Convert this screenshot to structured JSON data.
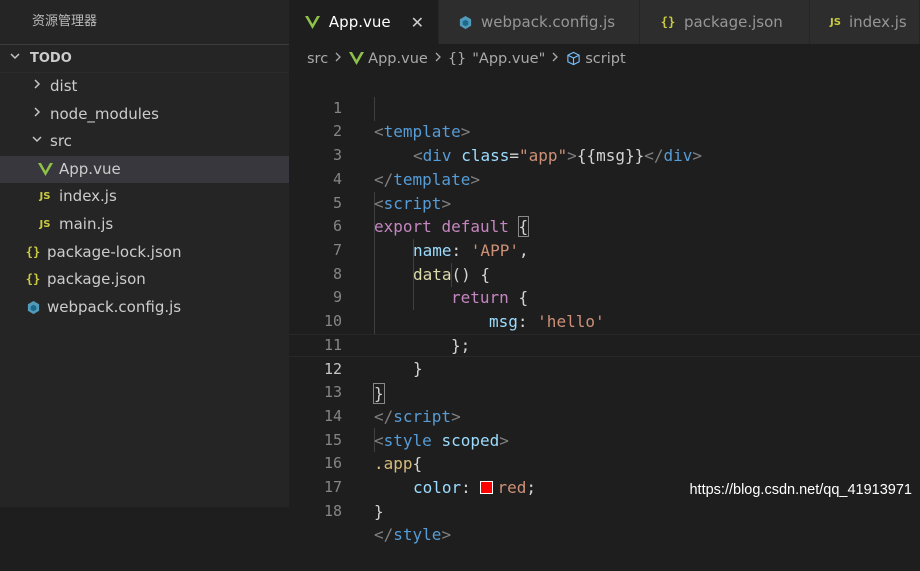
{
  "sidebar": {
    "title": "资源管理器",
    "section": "TODO",
    "items": [
      {
        "label": "dist",
        "kind": "folder",
        "open": false
      },
      {
        "label": "node_modules",
        "kind": "folder",
        "open": false
      },
      {
        "label": "src",
        "kind": "folder",
        "open": true
      },
      {
        "label": "App.vue",
        "kind": "vue",
        "selected": true
      },
      {
        "label": "index.js",
        "kind": "js"
      },
      {
        "label": "main.js",
        "kind": "js"
      },
      {
        "label": "package-lock.json",
        "kind": "json"
      },
      {
        "label": "package.json",
        "kind": "json"
      },
      {
        "label": "webpack.config.js",
        "kind": "webpack"
      }
    ]
  },
  "tabs": [
    {
      "label": "App.vue",
      "kind": "vue",
      "active": true
    },
    {
      "label": "webpack.config.js",
      "kind": "webpack"
    },
    {
      "label": "package.json",
      "kind": "json"
    },
    {
      "label": "index.js",
      "kind": "js"
    }
  ],
  "icons": {
    "js": "JS",
    "json": "{}",
    "close": "✕"
  },
  "breadcrumb": {
    "src": "src",
    "file": "App.vue",
    "object_icon": "{}",
    "object": "\"App.vue\"",
    "symbol": "script"
  },
  "editor": {
    "line_numbers": [
      "1",
      "2",
      "3",
      "4",
      "5",
      "6",
      "7",
      "8",
      "9",
      "10",
      "11",
      "12",
      "13",
      "14",
      "15",
      "16",
      "17",
      "18"
    ],
    "current_line": 12,
    "code": {
      "l1": [
        "<",
        "template",
        ">"
      ],
      "l2": [
        "<",
        "div",
        "class",
        "=",
        "\"app\"",
        ">",
        "{{msg}}",
        "</",
        "div",
        ">"
      ],
      "l3": [
        "</",
        "template",
        ">"
      ],
      "l4": [
        "<",
        "script",
        ">"
      ],
      "l5": [
        "export",
        "default",
        "{"
      ],
      "l6": [
        "name",
        ": ",
        "'APP'",
        ","
      ],
      "l7": [
        "data",
        "() {"
      ],
      "l8": [
        "return",
        "{"
      ],
      "l9": [
        "msg",
        ": ",
        "'hello'"
      ],
      "l10": [
        "};"
      ],
      "l11": [
        "}"
      ],
      "l12": [
        "}"
      ],
      "l13": [
        "</",
        "script",
        ">"
      ],
      "l14": [
        "<",
        "style",
        "scoped",
        ">"
      ],
      "l15": [
        ".app",
        "{"
      ],
      "l16": [
        "color",
        ": ",
        "red",
        ";"
      ],
      "l17": [
        "}"
      ],
      "l18": [
        "</",
        "style",
        ">"
      ]
    },
    "colors": {
      "red_swatch": "#ff0000"
    }
  },
  "watermark": "https://blog.csdn.net/qq_41913971"
}
